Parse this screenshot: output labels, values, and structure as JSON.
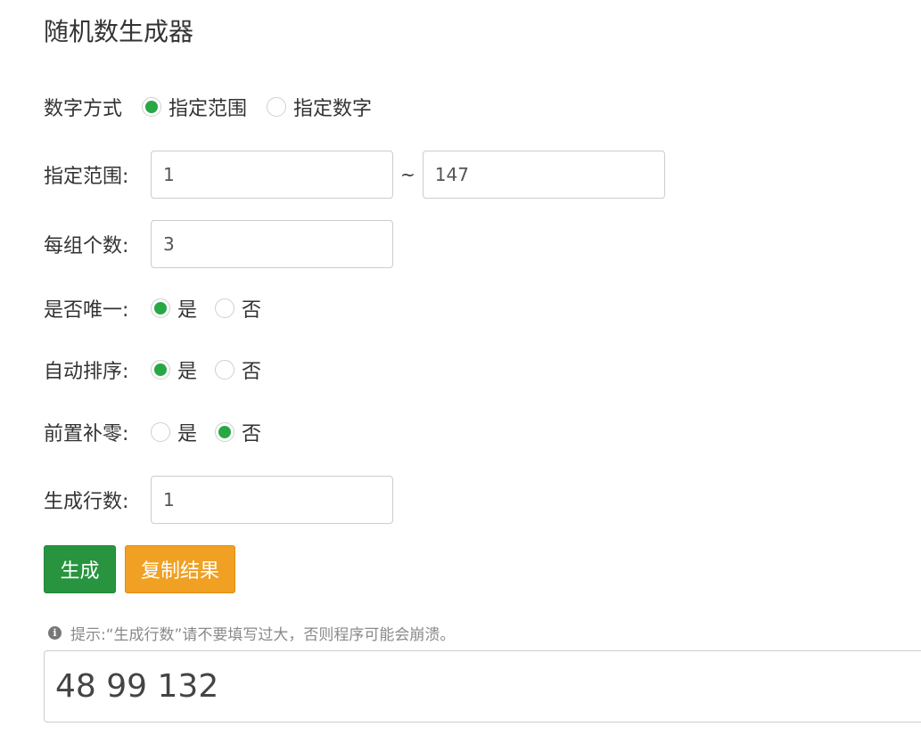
{
  "title": "随机数生成器",
  "number_mode": {
    "label": "数字方式",
    "options": [
      {
        "label": "指定范围",
        "checked": true
      },
      {
        "label": "指定数字",
        "checked": false
      }
    ]
  },
  "range": {
    "label": "指定范围:",
    "min": "1",
    "separator": "~",
    "max": "147"
  },
  "per_group": {
    "label": "每组个数:",
    "value": "3"
  },
  "unique": {
    "label": "是否唯一:",
    "yes": "是",
    "no": "否",
    "selected": "yes"
  },
  "auto_sort": {
    "label": "自动排序:",
    "yes": "是",
    "no": "否",
    "selected": "yes"
  },
  "zero_pad": {
    "label": "前置补零:",
    "yes": "是",
    "no": "否",
    "selected": "no"
  },
  "rows": {
    "label": "生成行数:",
    "value": "1"
  },
  "buttons": {
    "generate": "生成",
    "copy": "复制结果"
  },
  "hint": {
    "icon": "info-icon",
    "text": "提示:“生成行数”请不要填写过大，否则程序可能会崩溃。"
  },
  "result": "48 99 132",
  "colors": {
    "radio_checked": "#28a745",
    "generate_button": "#28943f",
    "copy_button": "#f0a023"
  }
}
